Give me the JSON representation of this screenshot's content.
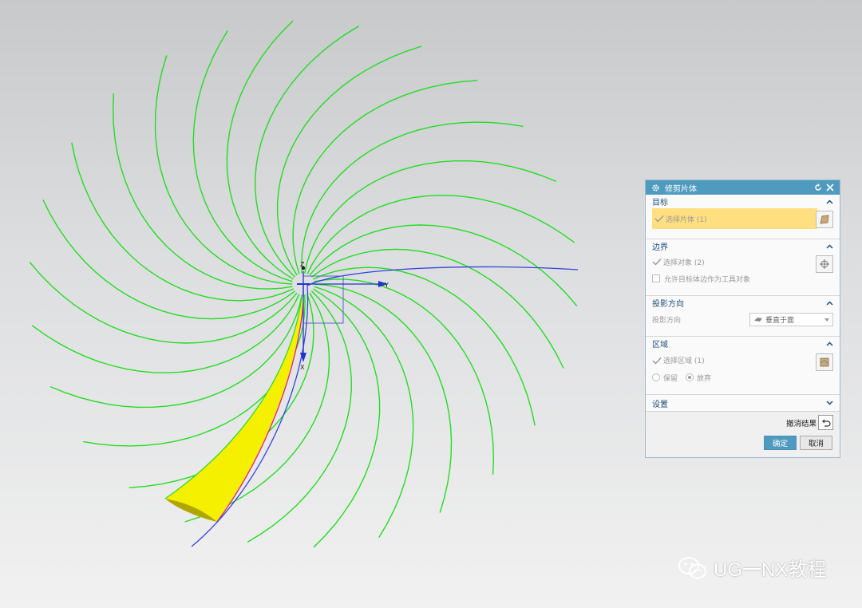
{
  "dialog": {
    "title": "修剪片体",
    "groups": {
      "target": {
        "label": "目标",
        "select_label": "选择片体 (1)"
      },
      "boundary": {
        "label": "边界",
        "select_label": "选择对象 (2)",
        "checkbox_label": "允许目标体边作为工具对象"
      },
      "projection": {
        "label": "投影方向",
        "field_label": "投影方向",
        "value": "垂直于面"
      },
      "region": {
        "label": "区域",
        "select_label": "选择区域 (1)",
        "keep_label": "保留",
        "discard_label": "放弃",
        "selected_option": "放弃"
      },
      "settings": {
        "label": "设置"
      }
    },
    "undo_label": "撤消结果",
    "ok_label": "确定",
    "cancel_label": "取消"
  },
  "axes": {
    "z": "Z",
    "y": "Y",
    "x": "X"
  },
  "watermark": "UG一NX教程",
  "colors": {
    "title_bar": "#4f9bc0",
    "curve_green": "#22dd22",
    "curve_blue": "#3344dd",
    "surface_yellow": "#ffff00",
    "highlight": "#ffdf7f"
  }
}
